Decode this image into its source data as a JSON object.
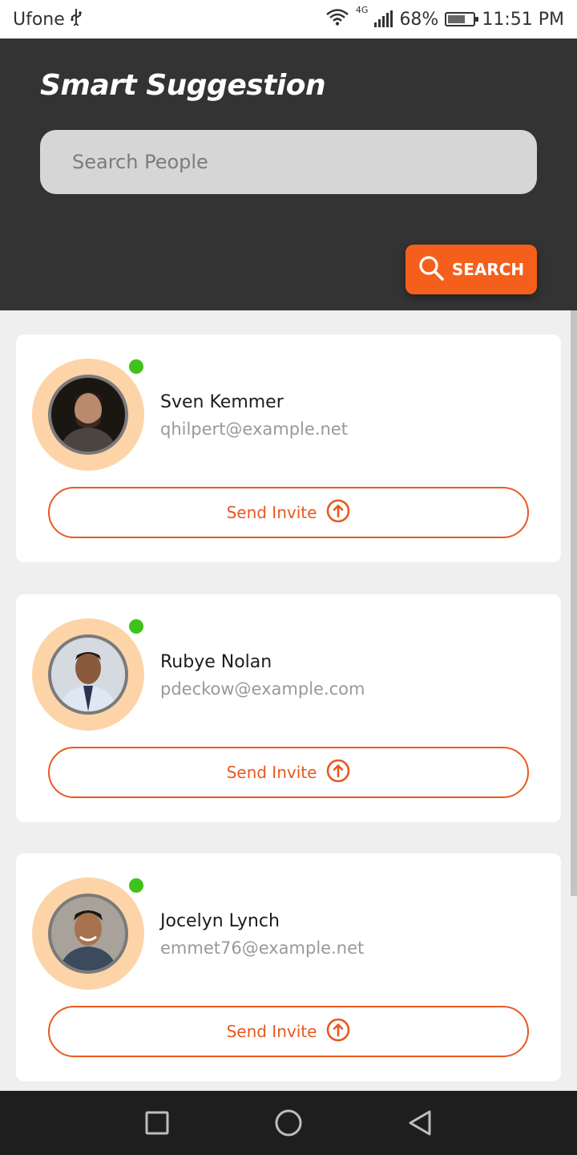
{
  "status_bar": {
    "carrier": "Ufone",
    "network": "4G",
    "battery": "68%",
    "battery_level": 0.68,
    "time": "11:51 PM"
  },
  "header": {
    "title": "Smart Suggestion",
    "search_placeholder": "Search People",
    "search_button_label": "SEARCH",
    "background_color": "#333333",
    "accent_color": "#f4601c"
  },
  "people": [
    {
      "name": "Sven Kemmer",
      "email": "qhilpert@example.net",
      "online": true,
      "invite_label": "Send Invite"
    },
    {
      "name": "Rubye Nolan",
      "email": "pdeckow@example.com",
      "online": true,
      "invite_label": "Send Invite"
    },
    {
      "name": "Jocelyn Lynch",
      "email": "emmet76@example.net",
      "online": true,
      "invite_label": "Send Invite"
    }
  ],
  "icons": {
    "usb": "usb-icon",
    "wifi": "wifi-icon",
    "signal": "signal-icon",
    "battery": "battery-icon",
    "search": "search-icon",
    "invite": "arrow-up-circle-icon",
    "nav_recents": "square-icon",
    "nav_home": "circle-icon",
    "nav_back": "triangle-back-icon"
  },
  "colors": {
    "online_dot": "#3fc31a",
    "avatar_ring": "#fdd4a8",
    "invite_border": "#e8591f"
  }
}
